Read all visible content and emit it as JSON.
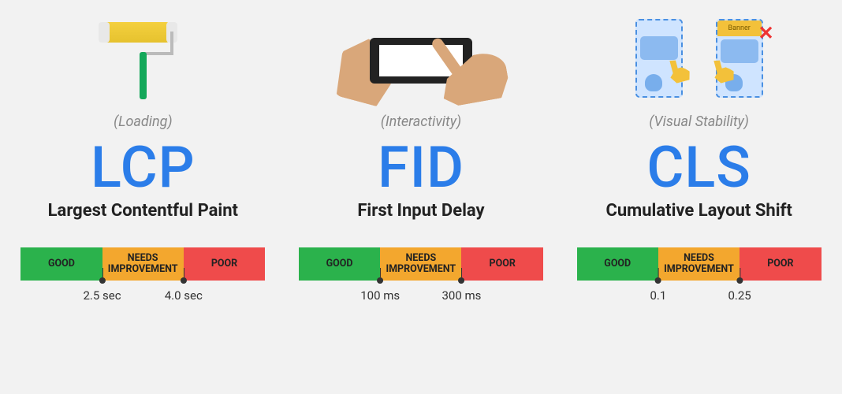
{
  "bar_labels": {
    "good": "GOOD",
    "needs": "NEEDS\nIMPROVEMENT",
    "poor": "POOR"
  },
  "metrics": [
    {
      "category": "(Loading)",
      "abbr": "LCP",
      "full": "Largest Contentful Paint",
      "threshold_low": "2.5 sec",
      "threshold_high": "4.0 sec"
    },
    {
      "category": "(Interactivity)",
      "abbr": "FID",
      "full": "First Input Delay",
      "threshold_low": "100 ms",
      "threshold_high": "300 ms"
    },
    {
      "category": "(Visual Stability)",
      "abbr": "CLS",
      "full": "Cumulative Layout Shift",
      "threshold_low": "0.1",
      "threshold_high": "0.25",
      "banner_text": "Banner"
    }
  ]
}
